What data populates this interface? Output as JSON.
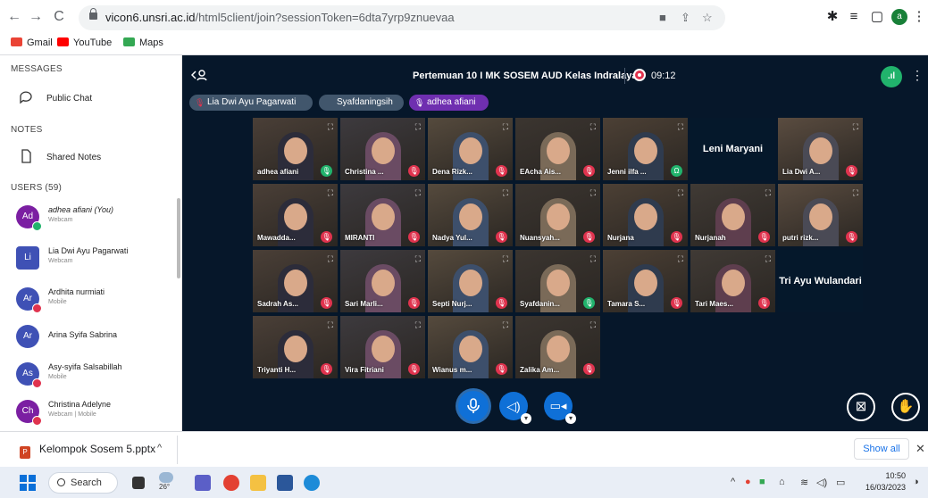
{
  "browser": {
    "url_host": "vicon6.unsri.ac.id",
    "url_path": "/html5client/join?sessionToken=6dta7yrp9znuevaa",
    "profile_initial": "a",
    "bookmarks": [
      "Gmail",
      "YouTube",
      "Maps"
    ]
  },
  "sidebar": {
    "messages_heading": "MESSAGES",
    "public_chat": "Public Chat",
    "notes_heading": "NOTES",
    "shared_notes": "Shared Notes",
    "users_heading": "USERS (59)",
    "users": [
      {
        "initials": "Ad",
        "name": "adhea afiani (You)",
        "sub": "Webcam",
        "color": "#7b1fa2"
      },
      {
        "initials": "Li",
        "name": "Lia Dwi Ayu Pagarwati",
        "sub": "Webcam",
        "color": "#3f51b5"
      },
      {
        "initials": "Ar",
        "name": "Ardhita nurmiati",
        "sub": "Mobile",
        "color": "#3f51b5"
      },
      {
        "initials": "Ar",
        "name": "Arina Syifa Sabrina",
        "sub": "",
        "color": "#3f51b5"
      },
      {
        "initials": "As",
        "name": "Asy-syifa Salsabillah",
        "sub": "Mobile",
        "color": "#3f51b5"
      },
      {
        "initials": "Ch",
        "name": "Christina Adelyne",
        "sub": "Webcam | Mobile",
        "color": "#7b1fa2"
      }
    ]
  },
  "meeting": {
    "title": "Pertemuan 10 I MK SOSEM AUD Kelas Indralaya",
    "timer": "09:12",
    "talkers": [
      "Lia Dwi Ayu Pagarwati",
      "Syafdaningsih",
      "adhea afiani"
    ]
  },
  "tiles": [
    {
      "name": "adhea afiani",
      "mic": "on",
      "type": "cam"
    },
    {
      "name": "Christina ...",
      "mic": "off",
      "type": "cam"
    },
    {
      "name": "Dena Rizk...",
      "mic": "off",
      "type": "cam"
    },
    {
      "name": "EAcha Ais...",
      "mic": "off",
      "type": "cam"
    },
    {
      "name": "Jenni ilfa ...",
      "mic": "listen",
      "type": "cam"
    },
    {
      "name": "Leni Maryani",
      "mic": "",
      "type": "blank"
    },
    {
      "name": "Lia Dwi A...",
      "mic": "off",
      "type": "cam"
    },
    {
      "name": "Mawadda...",
      "mic": "off",
      "type": "cam"
    },
    {
      "name": "MIRANTI",
      "mic": "off",
      "type": "cam"
    },
    {
      "name": "Nadya Yul...",
      "mic": "off",
      "type": "cam"
    },
    {
      "name": "Nuansyah...",
      "mic": "off",
      "type": "cam"
    },
    {
      "name": "Nurjana",
      "mic": "off",
      "type": "cam"
    },
    {
      "name": "Nurjanah",
      "mic": "off",
      "type": "cam"
    },
    {
      "name": "putri rizk...",
      "mic": "off",
      "type": "cam"
    },
    {
      "name": "Sadrah As...",
      "mic": "off",
      "type": "cam"
    },
    {
      "name": "Sari Marli...",
      "mic": "off",
      "type": "cam"
    },
    {
      "name": "Septi Nurj...",
      "mic": "off",
      "type": "cam"
    },
    {
      "name": "Syafdanin...",
      "mic": "on",
      "type": "cam"
    },
    {
      "name": "Tamara S...",
      "mic": "off",
      "type": "cam"
    },
    {
      "name": "Tari Maes...",
      "mic": "off",
      "type": "cam"
    },
    {
      "name": "Tri Ayu Wulandari",
      "mic": "",
      "type": "blank"
    },
    {
      "name": "Triyanti H...",
      "mic": "off",
      "type": "cam"
    },
    {
      "name": "Vira Fitriani",
      "mic": "off",
      "type": "cam"
    },
    {
      "name": "Wianus m...",
      "mic": "off",
      "type": "cam"
    },
    {
      "name": "Zalika Am...",
      "mic": "off",
      "type": "cam"
    }
  ],
  "download": {
    "file": "Kelompok Sosem 5.pptx",
    "show_all": "Show all"
  },
  "taskbar": {
    "search": "Search",
    "temp": "26°",
    "time": "10:50",
    "date": "16/03/2023"
  }
}
